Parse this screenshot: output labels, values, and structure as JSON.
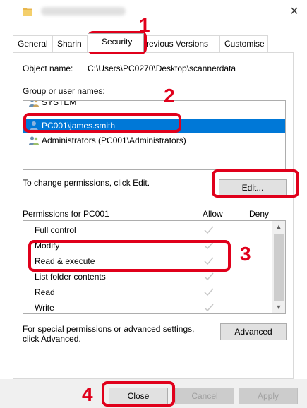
{
  "window": {
    "title_obscured": "scannerdata Properties",
    "close_glyph": "×"
  },
  "tabs": [
    {
      "label": "General"
    },
    {
      "label": "Sharin"
    },
    {
      "label": "Security"
    },
    {
      "label": "revious Versions"
    },
    {
      "label": "Customise"
    }
  ],
  "object": {
    "label": "Object name:",
    "path": "C:\\Users\\PC0270\\Desktop\\scannerdata"
  },
  "groups": {
    "label": "Group or user names:",
    "items": [
      {
        "name": "SYSTEM",
        "icon": "group-users-icon"
      },
      {
        "name": "PC001\\james.smith",
        "icon": "user-icon"
      },
      {
        "name": "Administrators (PC001\\Administrators)",
        "icon": "group-users-icon"
      }
    ],
    "selected_index": 1
  },
  "change": {
    "text": "To change permissions, click Edit.",
    "edit_label": "Edit..."
  },
  "permissions": {
    "header": "Permissions for PC001",
    "allow_label": "Allow",
    "deny_label": "Deny",
    "rows": [
      {
        "name": "Full control",
        "allow": true,
        "deny": false
      },
      {
        "name": "Modify",
        "allow": true,
        "deny": false
      },
      {
        "name": "Read & execute",
        "allow": true,
        "deny": false
      },
      {
        "name": "List folder contents",
        "allow": true,
        "deny": false
      },
      {
        "name": "Read",
        "allow": true,
        "deny": false
      },
      {
        "name": "Write",
        "allow": true,
        "deny": false
      }
    ]
  },
  "special": {
    "text": "For special permissions or advanced settings, click Advanced.",
    "advanced_label": "Advanced"
  },
  "footer": {
    "close_label": "Close",
    "cancel_label": "Cancel",
    "apply_label": "Apply"
  },
  "callouts": {
    "step1": "1",
    "step2": "2",
    "step3": "3",
    "step4": "4",
    "color": "#e0001b"
  },
  "colors": {
    "selection": "#0078d7",
    "check": "#c8c8c8"
  }
}
